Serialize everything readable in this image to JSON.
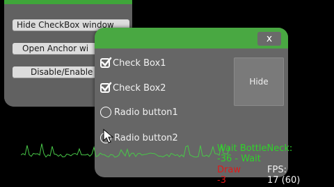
{
  "back_window": {
    "buttons": {
      "hide_checkbox_window": "Hide CheckBox window",
      "open_anchor": "Open Anchor wi",
      "disable_enable": "Disable/Enable"
    }
  },
  "front_window": {
    "close_label": "x",
    "options": [
      {
        "label": "Check Box1",
        "kind": "checkbox",
        "checked": true
      },
      {
        "label": "Check Box2",
        "kind": "checkbox",
        "checked": true
      },
      {
        "label": "Radio button1",
        "kind": "radio",
        "checked": false
      },
      {
        "label": "Radio button2",
        "kind": "radio",
        "checked": true
      }
    ],
    "hide_label": "Hide"
  },
  "stats": {
    "wait_bottleneck": "Wait BottleNeck:",
    "wait_value": "-36 - Wait",
    "draw_label": "Draw",
    "draw_value": "-3",
    "fps_label": "FPS:",
    "fps_value": "17 (60)"
  },
  "colors": {
    "title_green": "#49a842",
    "stat_green": "#2ed22a",
    "stat_red": "#e01818",
    "window_gray": "#666666"
  },
  "icons": [
    "checkmark-icon",
    "radio-icon",
    "close-icon",
    "mouse-cursor-icon"
  ]
}
